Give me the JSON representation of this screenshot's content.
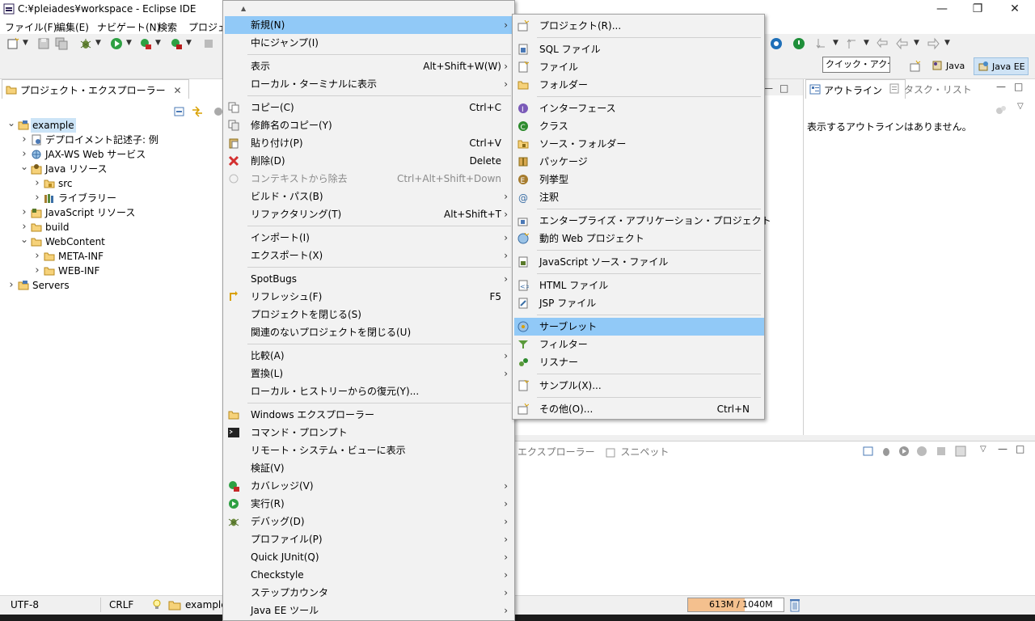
{
  "window": {
    "title": "C:¥pleiades¥workspace - Eclipse IDE",
    "minimize": "—",
    "restore": "❐",
    "close": "✕"
  },
  "menubar": [
    "ファイル(F)",
    "編集(E)",
    "ナビゲート(N)",
    "検索",
    "プロジェク"
  ],
  "toolbar": {
    "quick_access": "クイック・アクセス",
    "perspectives": [
      {
        "label": "Java",
        "active": false
      },
      {
        "label": "Java EE",
        "active": true
      }
    ]
  },
  "explorer": {
    "tab_label": "プロジェクト・エクスプローラー",
    "tree": [
      {
        "label": "example",
        "depth": 0,
        "expanded": true,
        "selected": true,
        "icon": "project-icon"
      },
      {
        "label": "デプロイメント記述子: 例",
        "depth": 1,
        "expanded": false,
        "icon": "descriptor-icon"
      },
      {
        "label": "JAX-WS Web サービス",
        "depth": 1,
        "expanded": false,
        "icon": "webservice-icon"
      },
      {
        "label": "Java リソース",
        "depth": 1,
        "expanded": true,
        "icon": "java-resources-icon"
      },
      {
        "label": "src",
        "depth": 2,
        "expanded": false,
        "icon": "package-folder-icon"
      },
      {
        "label": "ライブラリー",
        "depth": 2,
        "expanded": false,
        "icon": "library-icon"
      },
      {
        "label": "JavaScript リソース",
        "depth": 1,
        "expanded": false,
        "icon": "js-resources-icon"
      },
      {
        "label": "build",
        "depth": 1,
        "expanded": false,
        "icon": "folder-icon"
      },
      {
        "label": "WebContent",
        "depth": 1,
        "expanded": true,
        "icon": "folder-icon"
      },
      {
        "label": "META-INF",
        "depth": 2,
        "expanded": false,
        "icon": "folder-icon"
      },
      {
        "label": "WEB-INF",
        "depth": 2,
        "expanded": false,
        "icon": "folder-icon"
      },
      {
        "label": "Servers",
        "depth": 0,
        "expanded": false,
        "icon": "project-icon"
      }
    ]
  },
  "outline": {
    "tab_label": "アウトライン",
    "tab2_label": "タスク・リスト",
    "message": "表示するアウトラインはありません。"
  },
  "bottom": {
    "tabs_text": "エクスプローラー",
    "snippets_label": "スニペット"
  },
  "statusbar": {
    "encoding": "UTF-8",
    "line_ending": "CRLF",
    "project": "example",
    "heap": "613M / 1040M",
    "heap_used_fraction": 0.59
  },
  "context_menu": {
    "items": [
      {
        "type": "scroll",
        "label": "▲"
      },
      {
        "label": "新規(N)",
        "submenu": true,
        "highlighted": true
      },
      {
        "label": "中にジャンプ(I)"
      },
      {
        "type": "sep"
      },
      {
        "label": "表示",
        "shortcut": "Alt+Shift+W(W)",
        "submenu": true
      },
      {
        "label": "ローカル・ターミナルに表示",
        "submenu": true
      },
      {
        "type": "sep"
      },
      {
        "label": "コピー(C)",
        "shortcut": "Ctrl+C",
        "icon": "copy-icon"
      },
      {
        "label": "修飾名のコピー(Y)",
        "icon": "copy-qualified-icon"
      },
      {
        "label": "貼り付け(P)",
        "shortcut": "Ctrl+V",
        "icon": "paste-icon"
      },
      {
        "label": "削除(D)",
        "shortcut": "Delete",
        "icon": "delete-icon"
      },
      {
        "label": "コンテキストから除去",
        "shortcut": "Ctrl+Alt+Shift+Down",
        "disabled": true,
        "icon": "remove-context-icon"
      },
      {
        "label": "ビルド・パス(B)",
        "submenu": true
      },
      {
        "label": "リファクタリング(T)",
        "shortcut": "Alt+Shift+T",
        "submenu": true
      },
      {
        "type": "sep"
      },
      {
        "label": "インポート(I)",
        "submenu": true
      },
      {
        "label": "エクスポート(X)",
        "submenu": true
      },
      {
        "type": "sep"
      },
      {
        "label": "SpotBugs",
        "submenu": true
      },
      {
        "label": "リフレッシュ(F)",
        "shortcut": "F5",
        "icon": "refresh-icon"
      },
      {
        "label": "プロジェクトを閉じる(S)"
      },
      {
        "label": "関連のないプロジェクトを閉じる(U)"
      },
      {
        "type": "sep"
      },
      {
        "label": "比較(A)",
        "submenu": true
      },
      {
        "label": "置換(L)",
        "submenu": true
      },
      {
        "label": "ローカル・ヒストリーからの復元(Y)..."
      },
      {
        "type": "sep"
      },
      {
        "label": "Windows エクスプローラー",
        "icon": "folder-open-icon"
      },
      {
        "label": "コマンド・プロンプト",
        "icon": "terminal-icon"
      },
      {
        "label": "リモート・システム・ビューに表示"
      },
      {
        "label": "検証(V)"
      },
      {
        "label": "カバレッジ(V)",
        "submenu": true,
        "icon": "coverage-icon"
      },
      {
        "label": "実行(R)",
        "submenu": true,
        "icon": "run-icon"
      },
      {
        "label": "デバッグ(D)",
        "submenu": true,
        "icon": "debug-icon"
      },
      {
        "label": "プロファイル(P)",
        "submenu": true
      },
      {
        "label": "Quick JUnit(Q)",
        "submenu": true
      },
      {
        "label": "Checkstyle",
        "submenu": true
      },
      {
        "label": "ステップカウンタ",
        "submenu": true
      },
      {
        "label": "Java EE ツール",
        "submenu": true
      }
    ]
  },
  "new_submenu": {
    "items": [
      {
        "label": "プロジェクト(R)...",
        "icon": "new-project-icon"
      },
      {
        "type": "sep"
      },
      {
        "label": "SQL ファイル",
        "icon": "sql-file-icon"
      },
      {
        "label": "ファイル",
        "icon": "file-icon"
      },
      {
        "label": "フォルダー",
        "icon": "folder-icon"
      },
      {
        "type": "sep"
      },
      {
        "label": "インターフェース",
        "icon": "interface-icon"
      },
      {
        "label": "クラス",
        "icon": "class-icon"
      },
      {
        "label": "ソース・フォルダー",
        "icon": "source-folder-icon"
      },
      {
        "label": "パッケージ",
        "icon": "package-icon"
      },
      {
        "label": "列挙型",
        "icon": "enum-icon"
      },
      {
        "label": "注釈",
        "icon": "annotation-icon"
      },
      {
        "type": "sep"
      },
      {
        "label": "エンタープライズ・アプリケーション・プロジェクト",
        "icon": "ear-project-icon"
      },
      {
        "label": "動的 Web プロジェクト",
        "icon": "web-project-icon"
      },
      {
        "type": "sep"
      },
      {
        "label": "JavaScript ソース・ファイル",
        "icon": "js-file-icon"
      },
      {
        "type": "sep"
      },
      {
        "label": "HTML ファイル",
        "icon": "html-file-icon"
      },
      {
        "label": "JSP ファイル",
        "icon": "jsp-file-icon"
      },
      {
        "type": "sep"
      },
      {
        "label": "サーブレット",
        "icon": "servlet-icon",
        "highlighted": true
      },
      {
        "label": "フィルター",
        "icon": "filter-icon"
      },
      {
        "label": "リスナー",
        "icon": "listener-icon"
      },
      {
        "type": "sep"
      },
      {
        "label": "サンプル(X)...",
        "icon": "sample-icon"
      },
      {
        "type": "sep"
      },
      {
        "label": "その他(O)...",
        "shortcut": "Ctrl+N",
        "icon": "other-wizard-icon"
      }
    ]
  },
  "colors": {
    "highlight": "#91c9f7",
    "selection": "#cce4f7",
    "heap_fill": "#f4c08e"
  }
}
